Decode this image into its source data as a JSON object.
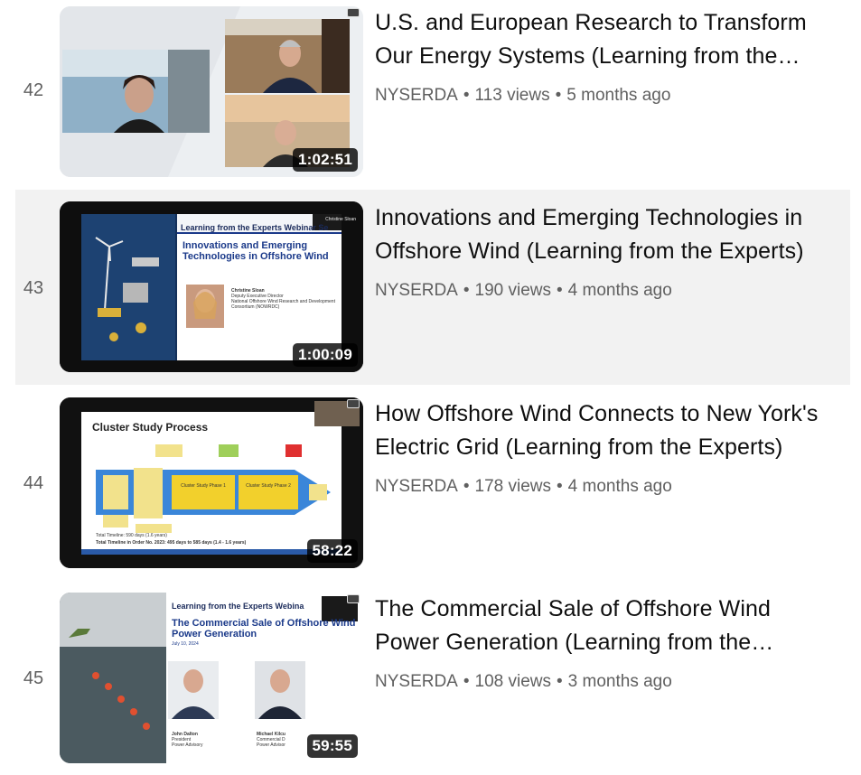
{
  "channel": "NYSERDA",
  "videos": [
    {
      "index": "42",
      "title_line1": "U.S. and European Research to Transform",
      "title_line2": "Our Energy Systems (Learning from the…",
      "views": "113 views",
      "age": "5 months ago",
      "duration": "1:02:51"
    },
    {
      "index": "43",
      "title_line1": "Innovations and Emerging Technologies in",
      "title_line2": "Offshore Wind (Learning from the Experts)",
      "views": "190 views",
      "age": "4 months ago",
      "duration": "1:00:09",
      "slide": {
        "header": "Learning from the Experts Webinar Se",
        "title": "Innovations and Emerging Technologies in Offshore Wind",
        "speaker": "Christine Sloan",
        "role": "Deputy Executive Director",
        "org": "National Offshore Wind Research and Development Consortium (NOWRDC)",
        "tag": "Christine Sloan"
      }
    },
    {
      "index": "44",
      "title_line1": "How Offshore Wind Connects to New York's",
      "title_line2": "Electric Grid (Learning from the Experts)",
      "views": "178 views",
      "age": "4 months ago",
      "duration": "58:22",
      "slide": {
        "title": "Cluster Study Process",
        "phase1": "Cluster Study Phase 1",
        "phase2": "Cluster Study Phase 2",
        "total1": "Total Timeline: 590 days (1.6 years)",
        "total2": "Total Timeline in Order No. 2023: 495 days to 585 days (1.4 - 1.6 years)"
      }
    },
    {
      "index": "45",
      "title_line1": "The Commercial Sale of Offshore Wind",
      "title_line2": "Power Generation (Learning from the…",
      "views": "108 views",
      "age": "3 months ago",
      "duration": "59:55",
      "slide": {
        "header": "Learning from the Experts Webina",
        "title": "The Commercial Sale of Offshore Wind Power Generation",
        "date": "July 10, 2024",
        "speaker1": "John Dalton",
        "speaker1_role": "President",
        "speaker1_org": "Power Advisory",
        "speaker2": "Michael Kilcu",
        "speaker2_role": "Commercial D",
        "speaker2_org": "Power Advisor"
      }
    }
  ],
  "colors": {
    "active_row": "#f2f2f2",
    "meta_text": "#606060",
    "title_text": "#0f0f0f",
    "slide_blue": "#1b3a8a"
  }
}
